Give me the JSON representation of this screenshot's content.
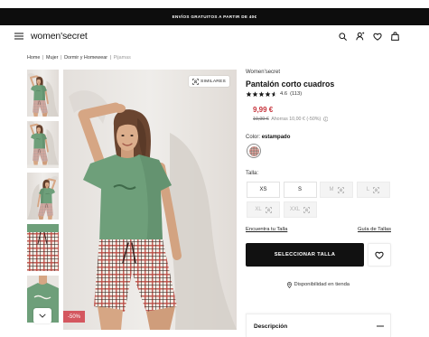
{
  "theme": {
    "promo_bg": "#0d0d0d",
    "price_color": "#c6333b",
    "badge_color": "#d4575f",
    "primary_button": "#111111"
  },
  "promo_bar": {
    "text": "ENVÍOS GRATUITOS A PARTIR DE 40€"
  },
  "header": {
    "logo": "women'secret",
    "icons": {
      "menu": "menu-icon",
      "search": "search-icon",
      "account": "user-icon",
      "wishlist": "heart-icon",
      "cart": "bag-icon"
    }
  },
  "breadcrumb": {
    "separator": "|",
    "items": [
      {
        "label": "Home"
      },
      {
        "label": "Mujer"
      },
      {
        "label": "Dormir y Homewear"
      },
      {
        "label": "Pijamas",
        "current": true
      }
    ]
  },
  "gallery": {
    "similar_label": "SIMILARES",
    "similar_icon": "similar-icon",
    "discount_badge": "-50%",
    "scroll_icon": "chevron-down-icon"
  },
  "product": {
    "brand": "Women'secret",
    "name": "Pantalón corto cuadros",
    "rating": {
      "value": 4.6,
      "max": 5,
      "count_label": "(113)"
    },
    "price": {
      "current": "9,99 €",
      "original": "19,99 €",
      "savings": "Ahorras 10,00 € (-50%)"
    },
    "color": {
      "label": "Color:",
      "value": "estampado"
    },
    "size": {
      "label": "Talla:",
      "options": [
        {
          "label": "XS",
          "available": true
        },
        {
          "label": "S",
          "available": true
        },
        {
          "label": "M",
          "available": false
        },
        {
          "label": "L",
          "available": false
        },
        {
          "label": "XL",
          "available": false
        },
        {
          "label": "XXL",
          "available": false
        }
      ],
      "find_size": "Encuentra tu Talla",
      "size_guide": "Guía de Tallas"
    },
    "add_button": "SELECCIONAR TALLA",
    "store_availability": "Disponibilidad en tienda",
    "accordion": [
      {
        "label": "Descripción",
        "expanded": true
      }
    ]
  }
}
